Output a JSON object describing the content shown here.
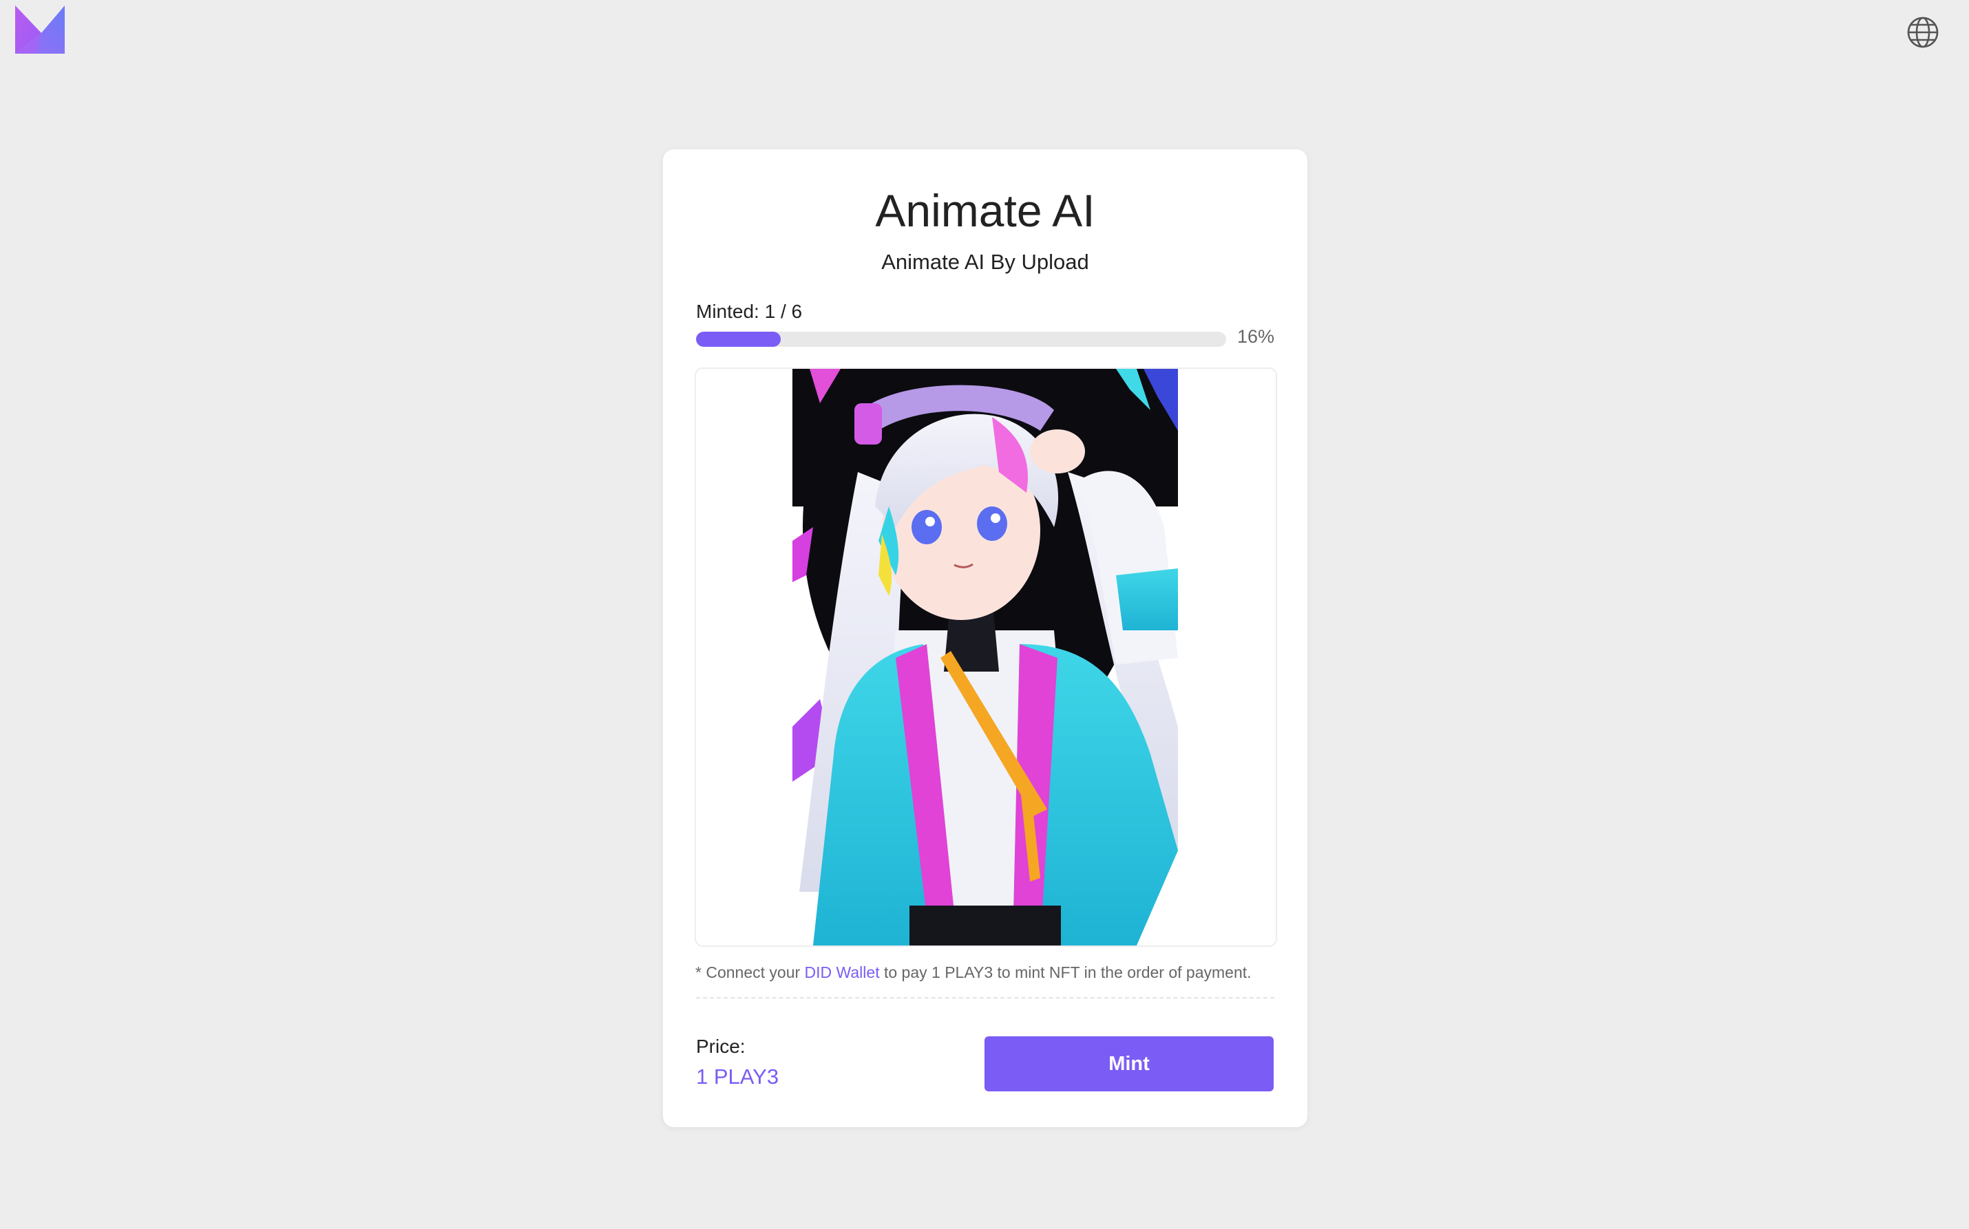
{
  "header": {
    "logo_icon": "brand-logo-icon",
    "language_icon": "globe-icon"
  },
  "card": {
    "title": "Animate AI",
    "subtitle": "Animate AI By Upload",
    "minted_text": "Minted: 1 / 6",
    "progress": {
      "percent_label": "16%",
      "fraction": 0.16
    },
    "preview_icon": "anime-artwork-image",
    "note": {
      "prefix": "* Connect your ",
      "link": "DID Wallet",
      "suffix": " to pay 1 PLAY3 to mint NFT in the order of payment."
    },
    "price_label": "Price:",
    "price_value": "1 PLAY3",
    "mint_label": "Mint"
  },
  "colors": {
    "accent": "#7b5cf5",
    "background": "#ededed",
    "card": "#ffffff"
  }
}
